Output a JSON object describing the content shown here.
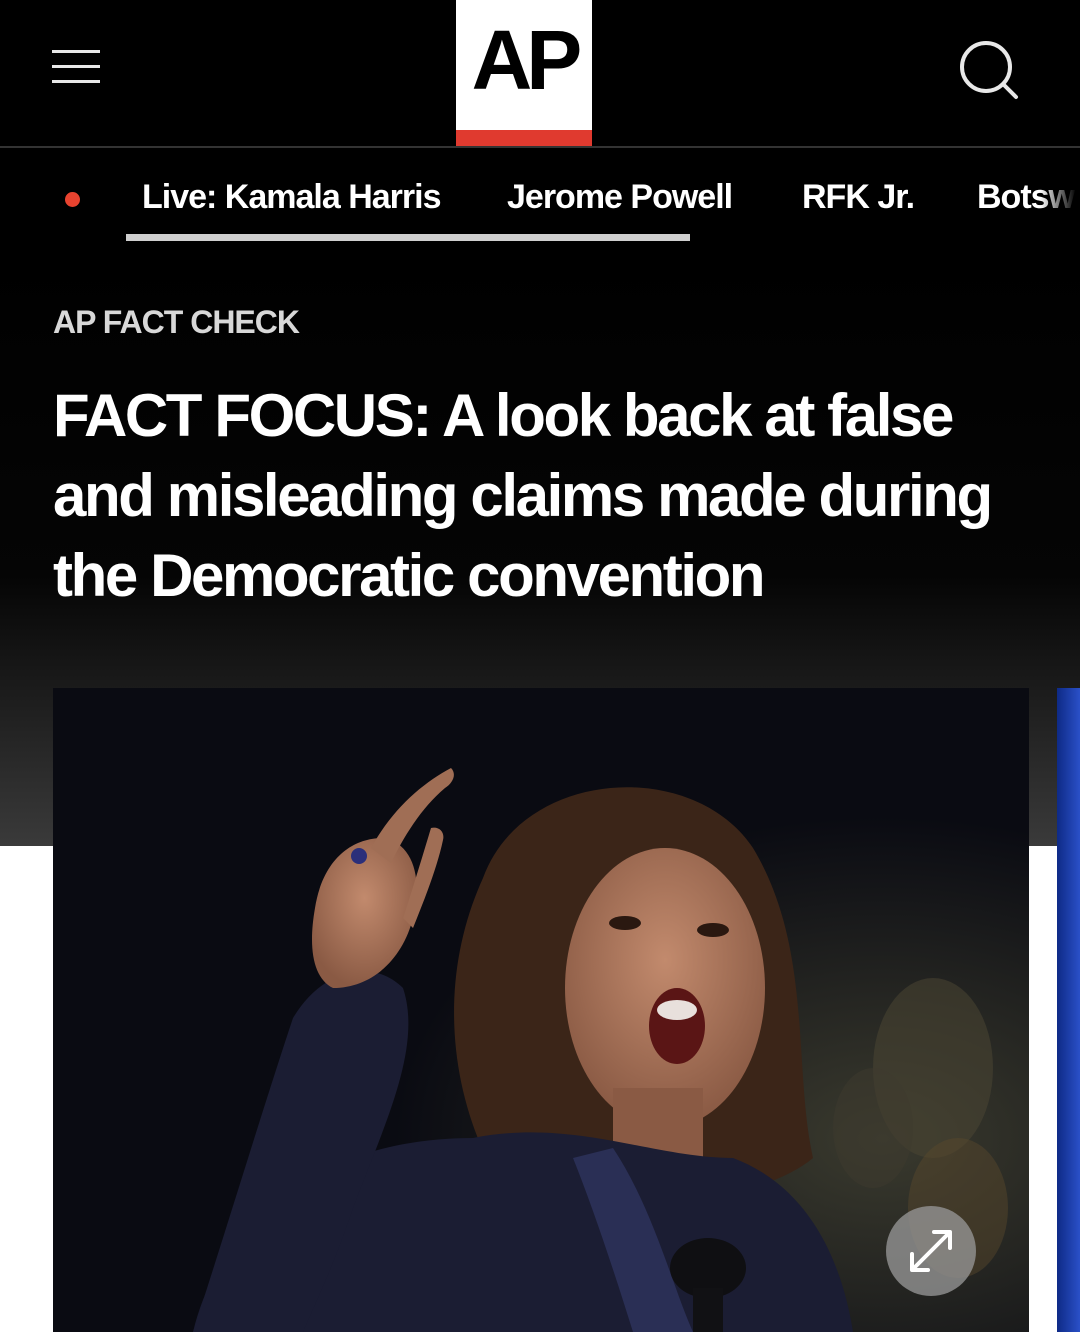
{
  "header": {
    "menu_icon": "hamburger-menu-icon",
    "logo_text": "AP",
    "logo_colors": {
      "background": "#ffffff",
      "text": "#000000",
      "accent": "#e03a2f"
    },
    "search_icon": "search-icon"
  },
  "trending": {
    "live_indicator_color": "#e8432f",
    "items": [
      {
        "label": "Live: Kamala Harris"
      },
      {
        "label": "Jerome Powell"
      },
      {
        "label": "RFK Jr."
      },
      {
        "label": "Botsw"
      }
    ]
  },
  "article": {
    "kicker": "AP FACT CHECK",
    "headline": "FACT FOCUS: A look back at false and misleading claims made during the Democratic convention",
    "lead_image": {
      "expand_icon": "expand-arrows-icon"
    }
  },
  "colors": {
    "background": "#000000",
    "text": "#ffffff",
    "kicker": "#d8d8d8",
    "next_image_edge": "#1f3fa8"
  }
}
